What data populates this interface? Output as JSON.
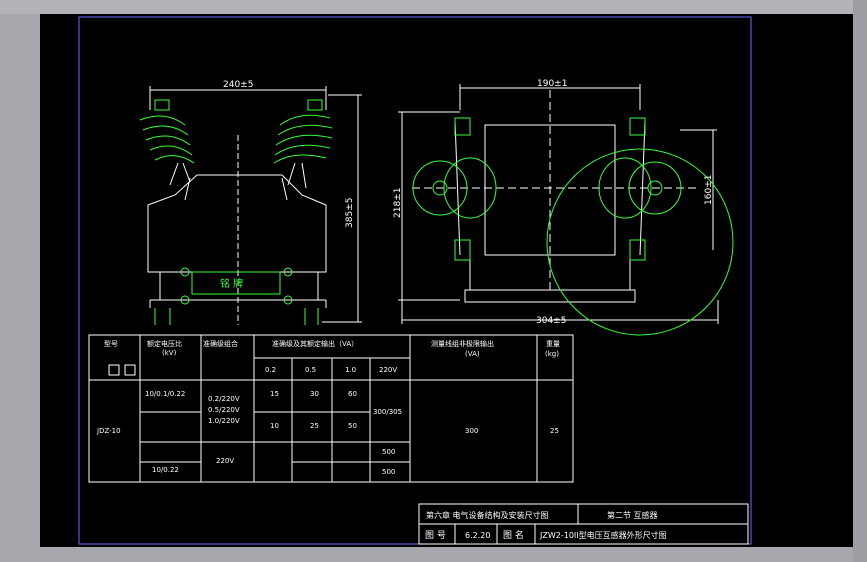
{
  "drawing": {
    "left_view": {
      "dim_width": "240±5",
      "dim_height": "385±5",
      "nameplate": "铭  牌"
    },
    "right_view": {
      "dim_top": "190±1",
      "dim_bottom": "304±5",
      "dim_left": "218±1",
      "dim_right": "160±1"
    }
  },
  "table": {
    "headers": {
      "model": "型号",
      "ratio": "额定电压比",
      "ratio_unit": "(kV)",
      "accuracy_combo": "准确级组合",
      "accuracy_output": "准确级及其额定输出（VA）",
      "limit_output": "测量线组非极限输出",
      "limit_unit": "(VA)",
      "weight": "重量",
      "weight_unit": "(kg)"
    },
    "classes": [
      "0.2",
      "0.5",
      "1.0",
      "220V"
    ],
    "model_name": "JDZ-10",
    "ratios": [
      "10/0.1/0.22",
      "10/0.22"
    ],
    "combos": [
      "0.2/220V",
      "0.5/220V",
      "1.0/220V",
      "220V"
    ],
    "row1": [
      "15",
      "30",
      "60"
    ],
    "row2": [
      "10",
      "25",
      "50"
    ],
    "merged_val": "300/305",
    "row3_val": "500",
    "row4_val": "500",
    "limit_val": "300",
    "weight_val": "25"
  },
  "title_block": {
    "chapter": "第六章  电气设备结构及安装尺寸图",
    "section": "第二节  互感器",
    "fig_label": "图  号",
    "fig_no": "6.2.20",
    "name_label": "图  名",
    "name": "JZW2-10II型电压互感器外形尺寸图"
  }
}
